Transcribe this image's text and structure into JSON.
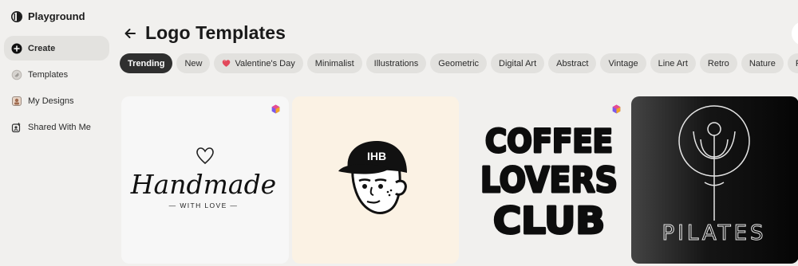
{
  "app": {
    "name": "Playground",
    "brand_icon": "playground-logo-icon"
  },
  "sidebar": {
    "items": [
      {
        "label": "Create",
        "icon": "plus-circle-icon",
        "active": true
      },
      {
        "label": "Templates",
        "icon": "templates-icon",
        "active": false
      },
      {
        "label": "My Designs",
        "icon": "my-designs-icon",
        "active": false
      },
      {
        "label": "Shared With Me",
        "icon": "shared-icon",
        "active": false
      }
    ]
  },
  "header": {
    "title": "Logo Templates",
    "back_icon": "arrow-left-icon"
  },
  "filters": {
    "chips": [
      {
        "label": "Trending",
        "active": true
      },
      {
        "label": "New"
      },
      {
        "label": "Valentine's Day",
        "icon": "heart-icon"
      },
      {
        "label": "Minimalist"
      },
      {
        "label": "Illustrations"
      },
      {
        "label": "Geometric"
      },
      {
        "label": "Digital Art"
      },
      {
        "label": "Abstract"
      },
      {
        "label": "Vintage"
      },
      {
        "label": "Line Art"
      },
      {
        "label": "Retro"
      },
      {
        "label": "Nature"
      },
      {
        "label": "Fl"
      }
    ]
  },
  "templates": [
    {
      "script": "Handmade",
      "tagline": "— WITH LOVE —",
      "background": "#f7f7f7",
      "pro": true,
      "icon": "heart-outline-icon"
    },
    {
      "cap_text": "IHB",
      "background": "#fbf2e4",
      "pro": false
    },
    {
      "lines": [
        "COFFEE",
        "LOVERS",
        "CLUB"
      ],
      "background": "#f1f0ee",
      "pro": true
    },
    {
      "word": "PILATES",
      "background": "#111111",
      "pro": false
    }
  ],
  "colors": {
    "accent_dark": "#2f2f2f",
    "chip_bg": "#e2e1de",
    "page_bg": "#f1f0ee"
  }
}
